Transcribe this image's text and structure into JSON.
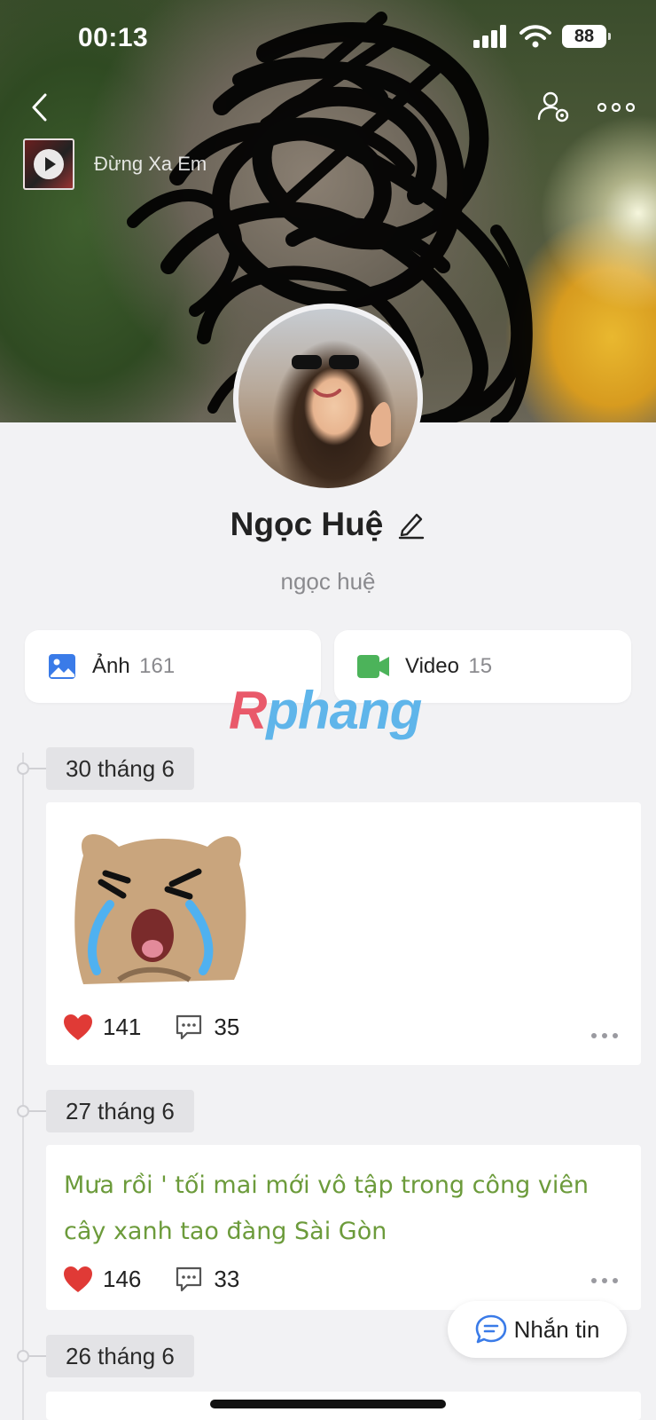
{
  "status_bar": {
    "time": "00:13",
    "battery": "88"
  },
  "nav": {
    "back_icon": "chevron-left-icon",
    "actions": [
      "user-settings-icon",
      "more-horizontal-icon"
    ]
  },
  "music": {
    "title": "Đừng Xa Em"
  },
  "profile": {
    "name": "Ngọc Huệ",
    "username": "ngọc huệ"
  },
  "media": [
    {
      "label": "Ảnh",
      "count": "161",
      "icon": "photo-icon",
      "color": "#3a7be8"
    },
    {
      "label": "Video",
      "count": "15",
      "icon": "video-icon",
      "color": "#4cb35a"
    }
  ],
  "watermark": {
    "first": "R",
    "rest": "phang"
  },
  "timeline": [
    {
      "date": "30 tháng 6",
      "type": "image",
      "likes": "141",
      "comments": "35"
    },
    {
      "date": "27 tháng 6",
      "type": "text",
      "text": "Mưa rồi ' tối mai mới vô tập trong công viên cây xanh tao đàng Sài Gòn",
      "likes": "146",
      "comments": "33"
    },
    {
      "date": "26 tháng 6"
    }
  ],
  "chat_button": {
    "label": "Nhắn tin"
  },
  "colors": {
    "heart": "#e03a36",
    "post_text": "#6c9b3b",
    "background": "#f2f2f4"
  }
}
